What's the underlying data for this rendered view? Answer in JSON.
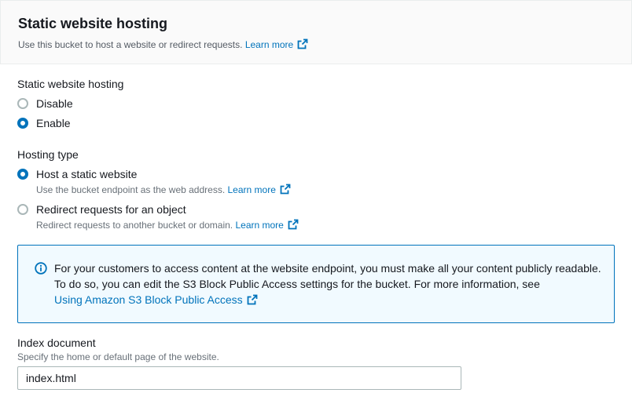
{
  "header": {
    "title": "Static website hosting",
    "subtitle": "Use this bucket to host a website or redirect requests.",
    "learn_more": "Learn more"
  },
  "hosting": {
    "label": "Static website hosting",
    "options": [
      {
        "label": "Disable",
        "checked": false
      },
      {
        "label": "Enable",
        "checked": true
      }
    ]
  },
  "hosting_type": {
    "label": "Hosting type",
    "options": [
      {
        "label": "Host a static website",
        "description": "Use the bucket endpoint as the web address.",
        "learn_more": "Learn more",
        "checked": true
      },
      {
        "label": "Redirect requests for an object",
        "description": "Redirect requests to another bucket or domain.",
        "learn_more": "Learn more",
        "checked": false
      }
    ]
  },
  "info": {
    "text": "For your customers to access content at the website endpoint, you must make all your content publicly readable. To do so, you can edit the S3 Block Public Access settings for the bucket. For more information, see",
    "link": "Using Amazon S3 Block Public Access"
  },
  "index_document": {
    "label": "Index document",
    "description": "Specify the home or default page of the website.",
    "value": "index.html"
  },
  "colors": {
    "accent": "#0073bb",
    "info_bg": "#f1faff"
  },
  "icons": [
    "external-link-icon",
    "info-icon"
  ]
}
